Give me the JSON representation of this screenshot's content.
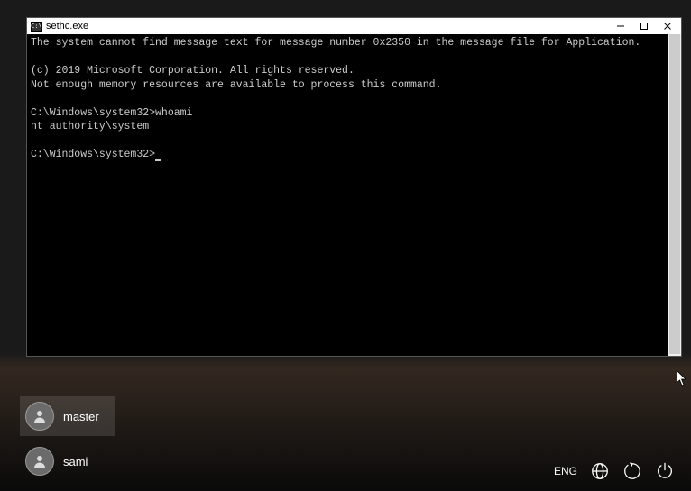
{
  "window": {
    "title": "sethc.exe",
    "icon_label": "cmd-icon"
  },
  "terminal": {
    "lines": {
      "l1": "The system cannot find message text for message number 0x2350 in the message file for Application.",
      "l2": "",
      "l3": "(c) 2019 Microsoft Corporation. All rights reserved.",
      "l4": "Not enough memory resources are available to process this command.",
      "l5": "",
      "l6_prompt": "C:\\Windows\\system32>",
      "l6_cmd": "whoami",
      "l7": "nt authority\\system",
      "l8": "",
      "l9_prompt": "C:\\Windows\\system32>"
    }
  },
  "users": [
    {
      "name": "master",
      "selected": true
    },
    {
      "name": "sami",
      "selected": false
    }
  ],
  "tray": {
    "language": "ENG"
  }
}
